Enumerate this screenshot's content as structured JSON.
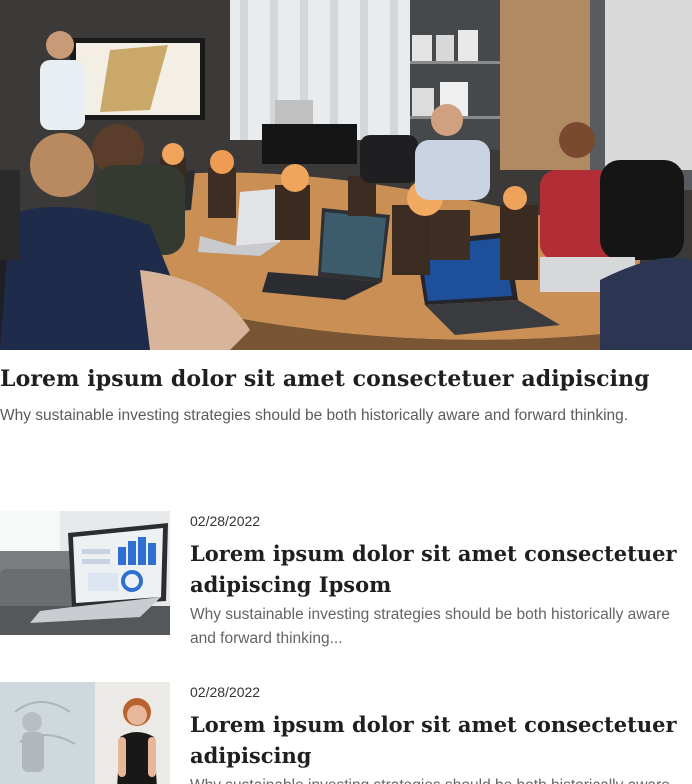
{
  "hero": {
    "title": "Lorem ipsum dolor sit amet consectetuer adipiscing",
    "subtitle": "Why sustainable investing strategies should be both historically aware and forward thinking.",
    "image_icon": "meeting-room-photo"
  },
  "articles": [
    {
      "date": "02/28/2022",
      "title": "Lorem ipsum dolor sit amet consectetuer adipiscing Ipsom",
      "excerpt": "Why sustainable investing strategies should be both historically aware and forward thinking...",
      "image_icon": "laptop-dashboard-photo"
    },
    {
      "date": "02/28/2022",
      "title": "Lorem ipsum dolor sit amet consectetuer adipiscing",
      "excerpt": "Why sustainable investing strategies should be both historically aware and forward thinking...",
      "image_icon": "woman-presenting-photo"
    }
  ]
}
